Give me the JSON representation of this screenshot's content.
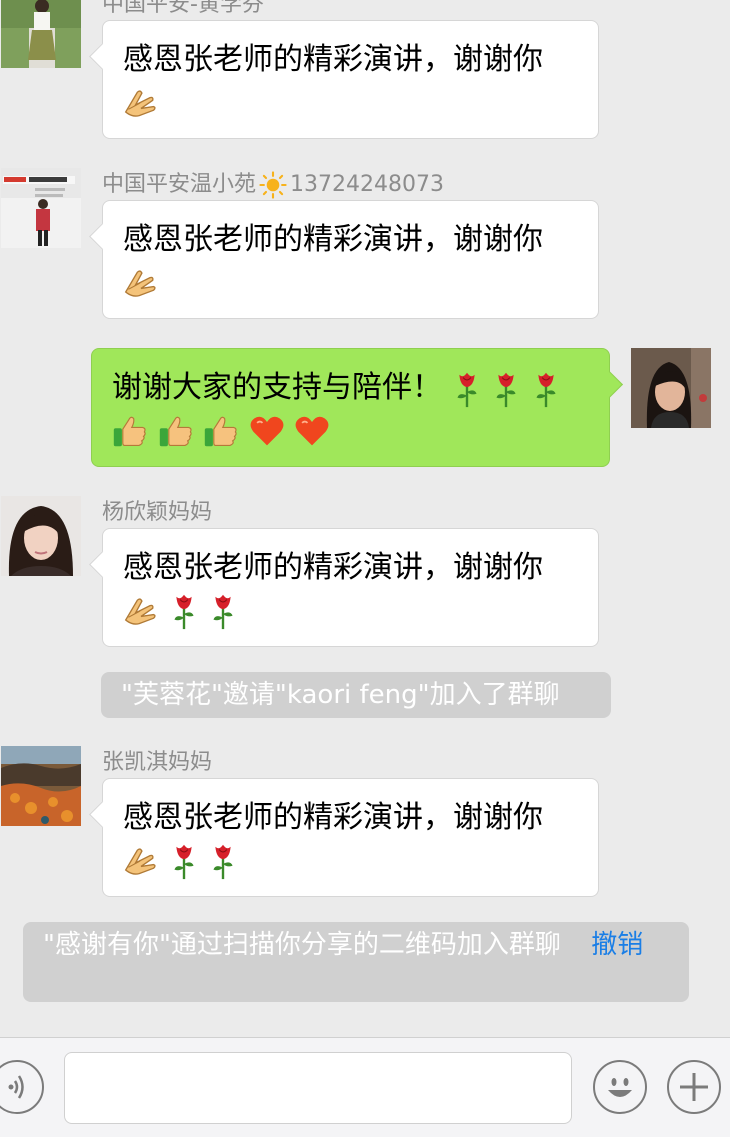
{
  "messages": [
    {
      "sender": "中国平安-黄学芬",
      "text": "感恩张老师的精彩演讲，谢谢你"
    },
    {
      "sender_name": "中国平安温小苑",
      "sender_phone": "13724248073",
      "text": "感恩张老师的精彩演讲，谢谢你"
    },
    {
      "text": "谢谢大家的支持与陪伴！"
    },
    {
      "sender": "杨欣颖妈妈",
      "text": "感恩张老师的精彩演讲，谢谢你"
    },
    {
      "sender": "张凯淇妈妈",
      "text": "感恩张老师的精彩演讲，谢谢你"
    }
  ],
  "system_messages": [
    {
      "text": "\"芙蓉花\"邀请\"kaori  feng\"加入了群聊"
    },
    {
      "text": "\"感谢有你\"通过扫描你分享的二维码加入群聊",
      "action": "撤销"
    }
  ],
  "icons": {
    "clap": "pray-hands-icon",
    "rose": "rose-icon",
    "thumbs": "thumbs-up-icon",
    "heart": "heart-icon",
    "sun": "sun-icon"
  },
  "colors": {
    "background": "#ebebeb",
    "my_bubble": "#a0e75a",
    "other_bubble": "#ffffff",
    "system_bubble": "#d0d0d0",
    "link": "#1a7ee6"
  }
}
